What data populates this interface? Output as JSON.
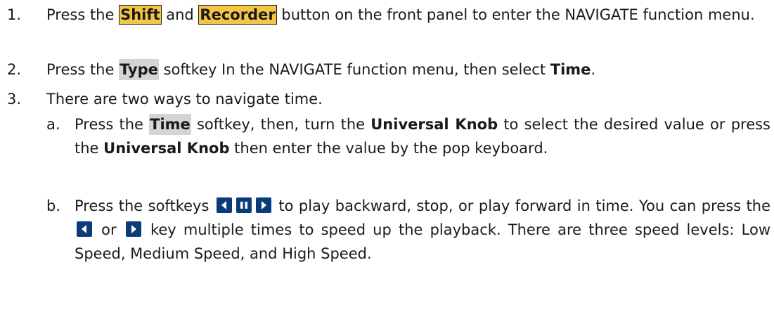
{
  "steps": [
    {
      "number": "1.",
      "pre": "Press the ",
      "key1": "Shift",
      "mid": " and ",
      "key2": "Recorder",
      "post": " button on the front panel to enter the NAVIGATE function menu."
    },
    {
      "number": "2.",
      "pre": "Press the ",
      "softkey": "Type",
      "mid": " softkey In the NAVIGATE function menu, then select ",
      "bold": "Time",
      "post": "."
    },
    {
      "number": "3.",
      "text": "There are two ways to navigate time."
    }
  ],
  "substeps": [
    {
      "letter": "a.",
      "pre": "Press the ",
      "softkey": "Time",
      "mid1": " softkey, then, turn the ",
      "bold1": "Universal Knob",
      "mid2": " to select the desired value or press the ",
      "bold2": "Universal Knob",
      "post": " then enter the value by the pop keyboard."
    },
    {
      "letter": "b.",
      "pre": "Press the softkeys",
      "mid1": " to play backward, stop, or play forward in time. You can press the",
      "or": " or ",
      "post": " key multiple times to speed up the playback. There are three speed levels: Low Speed, Medium Speed, and High Speed."
    }
  ],
  "icons": [
    "play-backward-icon",
    "pause-icon",
    "play-forward-icon"
  ],
  "colors": {
    "key_highlight": "#f5c543",
    "softkey_highlight": "#d4d4d4",
    "icon_bg": "#0b3c7a"
  }
}
